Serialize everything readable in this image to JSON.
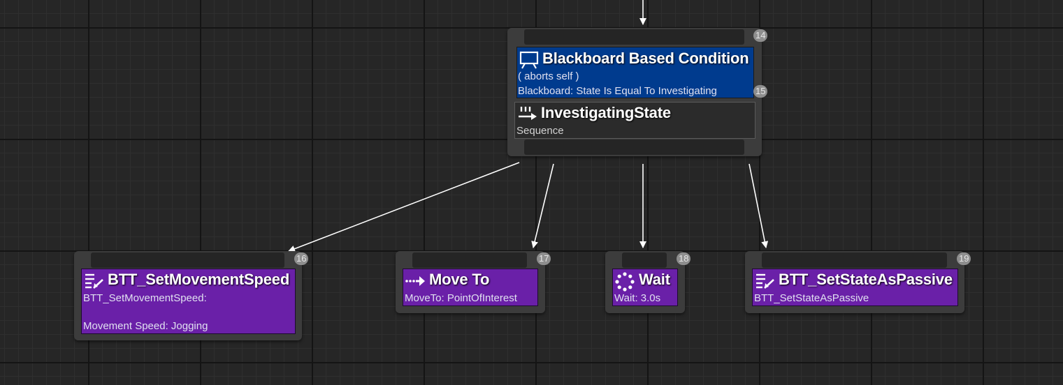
{
  "colors": {
    "background": "#262626",
    "node_body": "#3c3c3c",
    "decorator": "#003b8e",
    "task": "#6a20a8",
    "composite": "#2b2b2b",
    "badge": "#8e8e8e",
    "wire": "#ffffff"
  },
  "composite_node": {
    "index_badge": "14",
    "decorator": {
      "icon": "blackboard-icon",
      "title": "Blackboard Based Condition",
      "aborts": "( aborts self )",
      "description": "Blackboard: State Is Equal To Investigating",
      "index_badge": "15"
    },
    "title": "InvestigatingState",
    "icon": "sequence-icon",
    "subtitle": "Sequence"
  },
  "children": [
    {
      "title": "BTT_SetMovementSpeed",
      "icon": "blueprint-task-icon",
      "description": "BTT_SetMovementSpeed:",
      "description_2": "Movement Speed: Jogging",
      "index_badge": "16"
    },
    {
      "title": "Move To",
      "icon": "move-to-icon",
      "description": "MoveTo: PointOfInterest",
      "index_badge": "17"
    },
    {
      "title": "Wait",
      "icon": "wait-icon",
      "description": "Wait: 3.0s",
      "index_badge": "18"
    },
    {
      "title": "BTT_SetStateAsPassive",
      "icon": "blueprint-task-icon",
      "description": "BTT_SetStateAsPassive",
      "index_badge": "19"
    }
  ]
}
